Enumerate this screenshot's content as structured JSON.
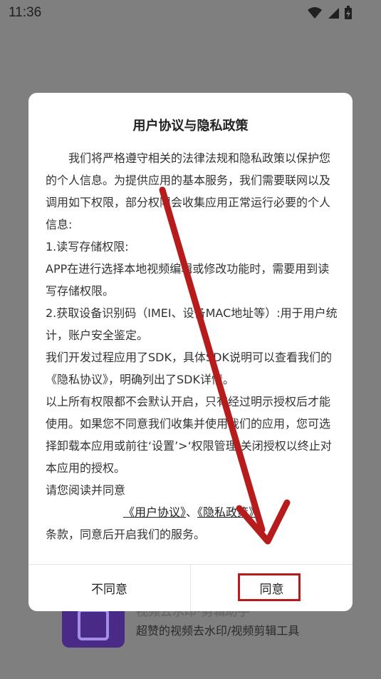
{
  "status_bar": {
    "time": "11:36",
    "icons": [
      "wifi-icon",
      "signal-icon",
      "battery-charging-icon"
    ]
  },
  "background_app": {
    "title": "视频去水印·剪辑助手",
    "subtitle": "超赞的视频去水印/视频剪辑工具"
  },
  "dialog": {
    "title": "用户协议与隐私政策",
    "paragraphs": [
      "我们将严格遵守相关的法律法规和隐私政策以保护您的个人信息。为提供应用的基本服务，我们需要联网以及调用如下权限，部分权限会收集应用正常运行必要的个人信息:",
      " 1.读写存储权限:",
      "APP在进行选择本地视频编辑或修改功能时，需要用到读写存储权限。",
      " 2.获取设备识别码（IMEI、设备MAC地址等）:用于用户统计，账户安全鉴定。",
      " 我们开发过程应用了SDK，具体SDK说明可以查看我们的《隐私协议》，明确列出了SDK详情。",
      " 以上所有权限都不会默认开启，只有经过明示授权后才能使用。如果您不同意我们收集并使用我们的应用，您可选择卸载本应用或前往‘设置’>‘权限管理’关闭授权以终止对本应用的授权。",
      "请您阅读并同意"
    ],
    "link_user_agreement": "《用户协议》",
    "link_separator": "、",
    "link_privacy_policy": "《隐私政策》",
    "closing": "条款，同意后开启我们的服务。",
    "disagree_label": "不同意",
    "agree_label": "同意"
  },
  "annotation_color": "#b71c1c"
}
